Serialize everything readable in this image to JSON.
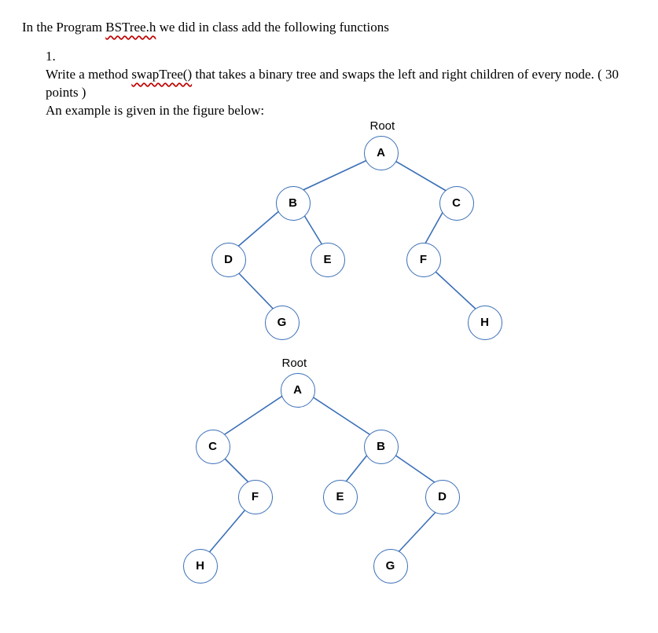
{
  "intro": {
    "prefix": "In the Program ",
    "filename": "BSTree.h",
    "suffix": " we did in class add the following functions"
  },
  "question": {
    "number": "1.",
    "line1_prefix": "Write a method ",
    "method_name": "swapTree()",
    "line1_suffix": " that takes a binary tree and swaps the left and right children of every node. ( 30 points )",
    "line2": "An example is given in the figure below:"
  },
  "tree_before": {
    "root_label": "Root",
    "nodes": {
      "A": "A",
      "B": "B",
      "C": "C",
      "D": "D",
      "E": "E",
      "F": "F",
      "G": "G",
      "H": "H"
    },
    "structure": {
      "A": {
        "left": "B",
        "right": "C"
      },
      "B": {
        "left": "D",
        "right": "E"
      },
      "C": {
        "left": "F",
        "right": null
      },
      "D": {
        "left": null,
        "right": "G"
      },
      "E": {
        "left": null,
        "right": null
      },
      "F": {
        "left": null,
        "right": "H"
      },
      "G": {
        "left": null,
        "right": null
      },
      "H": {
        "left": null,
        "right": null
      }
    }
  },
  "tree_after": {
    "root_label": "Root",
    "nodes": {
      "A": "A",
      "B": "B",
      "C": "C",
      "D": "D",
      "E": "E",
      "F": "F",
      "G": "G",
      "H": "H"
    },
    "structure": {
      "A": {
        "left": "C",
        "right": "B"
      },
      "C": {
        "left": null,
        "right": "F"
      },
      "B": {
        "left": "E",
        "right": "D"
      },
      "F": {
        "left": "H",
        "right": null
      },
      "E": {
        "left": null,
        "right": null
      },
      "D": {
        "left": "G",
        "right": null
      },
      "G": {
        "left": null,
        "right": null
      },
      "H": {
        "left": null,
        "right": null
      }
    }
  }
}
